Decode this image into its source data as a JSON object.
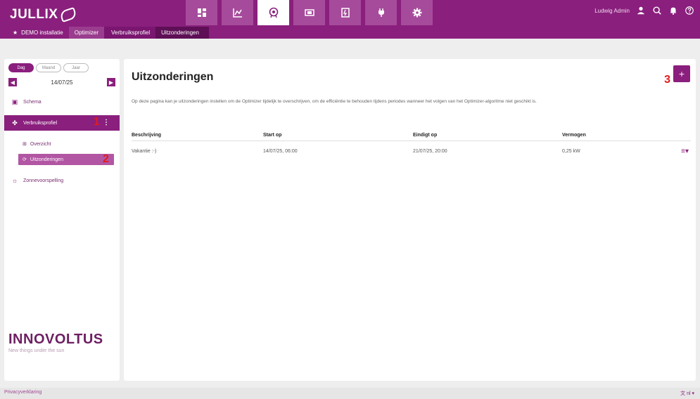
{
  "header": {
    "logo": "JULLIX",
    "user_name": "Ludwig Admin",
    "nav": [
      "dashboard-icon",
      "chart-icon",
      "optimizer-icon",
      "battery-icon",
      "meter-icon",
      "plug-icon",
      "gear-icon"
    ]
  },
  "breadcrumb": [
    "DEMO installatie",
    "Optimizer",
    "Verbruiksprofiel",
    "Uitzonderingen"
  ],
  "sidebar": {
    "periods": [
      "Dag",
      "Maand",
      "Jaar"
    ],
    "date": "14/07/25",
    "items": {
      "schema": "Schema",
      "verbruiksprofiel": "Verbruiksprofiel",
      "overzicht": "Overzicht",
      "uitzonderingen": "Uitzonderingen",
      "zonnevoorspelling": "Zonnevoorspelling"
    },
    "markers": [
      "1",
      "2"
    ],
    "brand_name": "INNOVOLTUS",
    "brand_tagline": "New things under the sun"
  },
  "main": {
    "title": "Uitzonderingen",
    "add_label": "+",
    "marker3": "3",
    "description": "Op deze pagina kan je uitzonderingen instellen om de Optimizer tijdelijk te overschrijven, om de efficiëntie te behouden tijdens periodes wanneer het volgen van het Optimizer-algoritme niet geschikt is.",
    "table": {
      "headers": [
        "Beschrijving",
        "Start op",
        "Eindigt op",
        "Vermogen"
      ],
      "rows": [
        [
          "Vakantie :-)",
          "14/07/25, 06:00",
          "21/07/25, 20:00",
          "0,25 kW"
        ]
      ]
    }
  },
  "footer": {
    "privacy": "Privacyverklaring",
    "lang": "文 nl ▾"
  },
  "colors": {
    "primary": "#8a1f7d",
    "marker": "#e21b1b"
  }
}
